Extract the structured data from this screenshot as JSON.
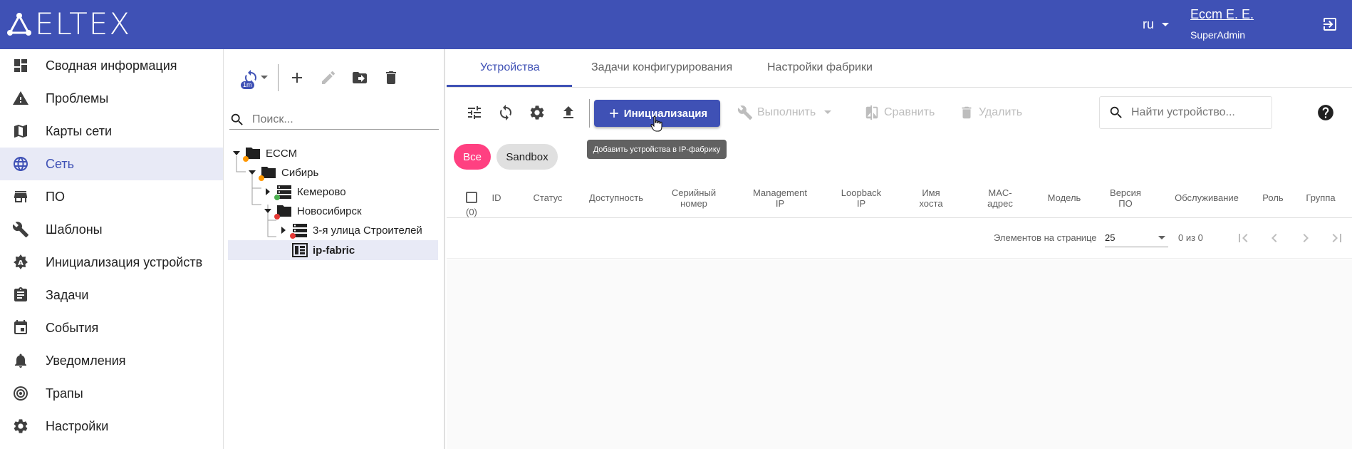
{
  "header": {
    "logo_text": "ELTEX",
    "lang": "ru",
    "user_name": "Eccm E. E.",
    "user_role": "SuperAdmin",
    "brand_color": "#3f51b5"
  },
  "sidebar": {
    "items": [
      {
        "label": "Сводная информация",
        "icon": "dashboard-icon"
      },
      {
        "label": "Проблемы",
        "icon": "warning-icon"
      },
      {
        "label": "Карты сети",
        "icon": "map-icon"
      },
      {
        "label": "Сеть",
        "icon": "globe-icon",
        "active": true
      },
      {
        "label": "ПО",
        "icon": "store-icon"
      },
      {
        "label": "Шаблоны",
        "icon": "wrench-icon"
      },
      {
        "label": "Инициализация устройств",
        "icon": "auto-init-icon"
      },
      {
        "label": "Задачи",
        "icon": "clipboard-icon"
      },
      {
        "label": "События",
        "icon": "calendar-icon"
      },
      {
        "label": "Уведомления",
        "icon": "bell-icon"
      },
      {
        "label": "Трапы",
        "icon": "trap-icon"
      },
      {
        "label": "Настройки",
        "icon": "gear-icon"
      }
    ]
  },
  "tree_panel": {
    "refresh_badge": "1m",
    "search_placeholder": "Поиск...",
    "nodes": [
      {
        "label": "ECCM",
        "bold": false
      },
      {
        "label": "Сибирь"
      },
      {
        "label": "Кемерово"
      },
      {
        "label": "Новосибирск"
      },
      {
        "label": "3-я улица Строителей"
      },
      {
        "label": "ip-fabric",
        "selected": true
      }
    ]
  },
  "main": {
    "tabs": [
      {
        "label": "Устройства",
        "active": true
      },
      {
        "label": "Задачи конфигурирования"
      },
      {
        "label": "Настройки фабрики"
      }
    ],
    "toolbar": {
      "init_label": "Инициализация",
      "execute_label": "Выполнить",
      "compare_label": "Сравнить",
      "delete_label": "Удалить",
      "search_placeholder": "Найти устройство..."
    },
    "tooltip": "Добавить устройства в IP-фабрику",
    "chips": [
      "Все",
      "Sandbox"
    ],
    "table": {
      "count": "(0)",
      "columns": [
        {
          "l1": "ID",
          "l2": ""
        },
        {
          "l1": "Статус",
          "l2": ""
        },
        {
          "l1": "Доступность",
          "l2": ""
        },
        {
          "l1": "Серийный",
          "l2": "номер"
        },
        {
          "l1": "Management",
          "l2": "IP"
        },
        {
          "l1": "Loopback",
          "l2": "IP"
        },
        {
          "l1": "Имя",
          "l2": "хоста"
        },
        {
          "l1": "MAC-",
          "l2": "адрес"
        },
        {
          "l1": "Модель",
          "l2": ""
        },
        {
          "l1": "Версия",
          "l2": "ПО"
        },
        {
          "l1": "Обслуживание",
          "l2": ""
        },
        {
          "l1": "Роль",
          "l2": ""
        },
        {
          "l1": "Группа",
          "l2": ""
        }
      ]
    },
    "paginator": {
      "label": "Элементов на странице",
      "page_size": "25",
      "range": "0 из 0"
    }
  }
}
